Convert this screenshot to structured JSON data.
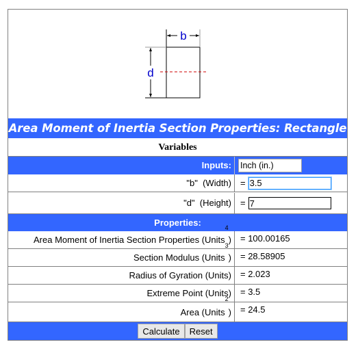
{
  "diagram": {
    "width_label": "b",
    "height_label": "d",
    "label_color": "#0000cc",
    "neutral_axis_color": "#cc0000"
  },
  "title": "Area Moment of Inertia Section Properties: Rectangle",
  "variables_heading": "Variables",
  "inputs": {
    "label": "Inputs:",
    "unit_selected": "Inch (in.)",
    "fields": [
      {
        "label": "\"b\"  (Width)",
        "equals": "=",
        "value": "3.5"
      },
      {
        "label": "\"d\"  (Height)",
        "equals": "=",
        "value": "7"
      }
    ]
  },
  "properties": {
    "heading": "Properties:",
    "rows": [
      {
        "label": "Area Moment of Inertia Section Properties (Units",
        "exp": "4",
        "close": ")",
        "value": "= 100.00165"
      },
      {
        "label": "Section Modulus (Units",
        "exp": "3",
        "close": ")",
        "value": "= 28.58905"
      },
      {
        "label": "Radius of Gyration (Units)",
        "exp": "",
        "close": "",
        "value": "= 2.023"
      },
      {
        "label": "Extreme Point (Units)",
        "exp": "",
        "close": "",
        "value": "= 3.5"
      },
      {
        "label": "Area (Units",
        "exp": "2",
        "close": ")",
        "value": "= 24.5"
      }
    ]
  },
  "buttons": {
    "calculate": "Calculate",
    "reset": "Reset"
  },
  "colors": {
    "header_blue": "#3366ff",
    "border_gray": "#808080"
  }
}
